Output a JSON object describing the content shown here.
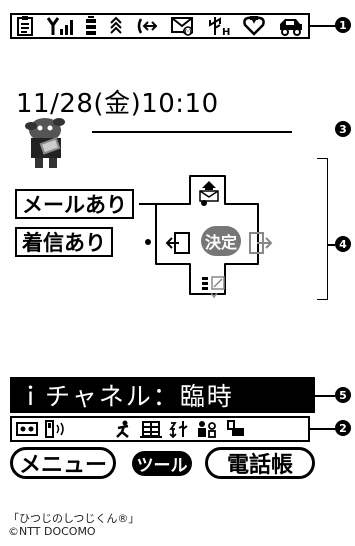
{
  "status_bar": {
    "icons": [
      "memo-icon",
      "signal-icon",
      "battery-icon",
      "network-icon",
      "infrared-icon",
      "mail-icon",
      "usb-icon",
      "heart-icon",
      "drive-mode-icon"
    ],
    "glyphs": [
      "📋",
      "Y",
      ".ıl",
      "▮",
      "≋",
      "(↔",
      "✉",
      "ψH",
      "♡",
      "⛟"
    ]
  },
  "clock": "11/28(金)10:10",
  "mascot_caption": "「ひつじのしつじくん®」",
  "copyright": "©NTT DOCOMO",
  "labels": {
    "mail": "メールあり",
    "incoming": "着信あり"
  },
  "center_key": {
    "label": "決定"
  },
  "channel_text": "ｉチャネル：臨時",
  "indicator_bar": {
    "icons": [
      "manner-mode-icon",
      "vibration-icon",
      "person-icon",
      "building-icon",
      "usb-mode-icon",
      "family-icon",
      "footprint-icon"
    ]
  },
  "soft_keys": {
    "left": "メニュー",
    "center": "ツール",
    "right": "電話帳"
  },
  "callouts": [
    "1",
    "2",
    "3",
    "4",
    "5"
  ]
}
